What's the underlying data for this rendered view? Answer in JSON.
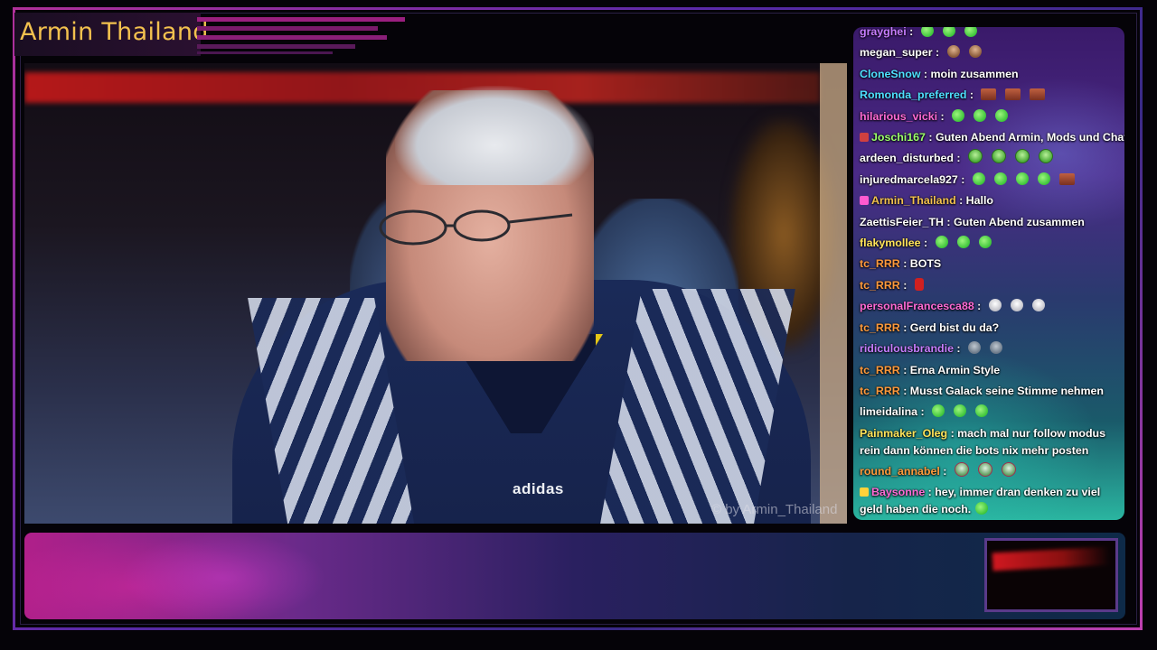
{
  "stream": {
    "title": "Armin Thailand",
    "video_logo": "adidas",
    "video_watermark": "© by Armin_Thailand"
  },
  "colors": {
    "title": "#f2c14e",
    "frame_accent": "#b0309a",
    "chat_white": "#ffffff"
  },
  "chat": {
    "messages": [
      {
        "user": "grayghei",
        "color": "#c77dff",
        "text": "",
        "emotes": [
          "green",
          "green",
          "green"
        ]
      },
      {
        "user": "megan_super",
        "color": "#ffffff",
        "text": "",
        "emotes": [
          "bald",
          "bald"
        ]
      },
      {
        "user": "CloneSnow",
        "color": "#4ee0ff",
        "text": "moin zusammen",
        "emotes": []
      },
      {
        "user": "Romonda_preferred",
        "color": "#4ee0ff",
        "text": "",
        "emotes": [
          "face",
          "face",
          "face"
        ]
      },
      {
        "user": "hilarious_vicki",
        "color": "#ff6ad5",
        "text": "",
        "emotes": [
          "green",
          "green",
          "green"
        ]
      },
      {
        "user": "Joschi167",
        "color": "#9bff6a",
        "text": "Guten Abend Armin, Mods und Chat",
        "emotes": [],
        "badge": "#d04040"
      },
      {
        "user": "ardeen_disturbed",
        "color": "#ffffff",
        "text": "",
        "emotes": [
          "frog",
          "frog",
          "frog",
          "frog"
        ]
      },
      {
        "user": "injuredmarcela927",
        "color": "#ffffff",
        "text": "",
        "emotes": [
          "green",
          "green",
          "green",
          "green",
          "face"
        ]
      },
      {
        "user": "Armin_Thailand",
        "color": "#f2c14e",
        "text": "Hallo",
        "emotes": [],
        "badge": "#ff5ad0"
      },
      {
        "user": "ZaettisFeier_TH",
        "color": "#ffffff",
        "text": "Guten Abend zusammen",
        "emotes": []
      },
      {
        "user": "flakymollee",
        "color": "#ffe45a",
        "text": "",
        "emotes": [
          "green",
          "green",
          "green"
        ]
      },
      {
        "user": "tc_RRR",
        "color": "#ff9a3c",
        "text": "BOTS",
        "emotes": []
      },
      {
        "user": "tc_RRR",
        "color": "#ff9a3c",
        "text": "",
        "emotes": [
          "red"
        ]
      },
      {
        "user": "personalFrancesca88",
        "color": "#ff6ad5",
        "text": "",
        "emotes": [
          "pig",
          "pig",
          "pig"
        ]
      },
      {
        "user": "tc_RRR",
        "color": "#ff9a3c",
        "text": "Gerd bist du da?",
        "emotes": []
      },
      {
        "user": "ridiculousbrandie",
        "color": "#c77dff",
        "text": "",
        "emotes": [
          "blob",
          "blob"
        ]
      },
      {
        "user": "tc_RRR",
        "color": "#ff9a3c",
        "text": "Erna Armin Style",
        "emotes": []
      },
      {
        "user": "tc_RRR",
        "color": "#ff9a3c",
        "text": "Musst Galack seine Stimme nehmen",
        "emotes": []
      },
      {
        "user": "limeidalina",
        "color": "#ffffff",
        "text": "",
        "emotes": [
          "green",
          "green",
          "green"
        ]
      },
      {
        "user": "Painmaker_Oleg",
        "color": "#ffe45a",
        "text": "mach mal nur follow modus rein dann können die bots nix mehr posten",
        "emotes": [],
        "wrap": true
      },
      {
        "user": "round_annabel",
        "color": "#ff9a3c",
        "text": "",
        "emotes": [
          "pbull",
          "pbull",
          "pbull"
        ]
      },
      {
        "user": "Baysonne",
        "color": "#ff6ad5",
        "text": "hey, immer dran denken zu viel geld haben die noch.",
        "emotes": [
          "green"
        ],
        "wrap": true,
        "badge": "#ffd23a"
      }
    ]
  }
}
